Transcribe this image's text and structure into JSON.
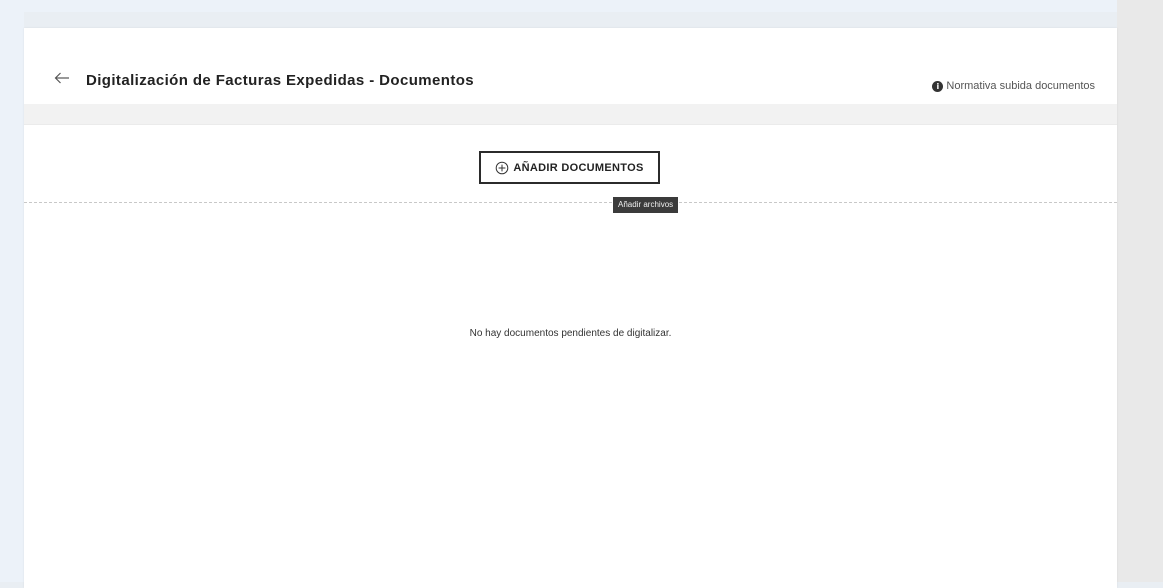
{
  "header": {
    "title": "Digitalización de Facturas Expedidas - Documentos",
    "back_icon": "arrow-left-icon",
    "help_link_label": "Normativa subida documentos",
    "help_icon": "info-icon"
  },
  "toolbar": {
    "add_button_label": "AÑADIR DOCUMENTOS",
    "add_button_icon": "plus-circle-icon",
    "tooltip": "Añadir archivos"
  },
  "main": {
    "empty_message": "No hay documentos pendientes de digitalizar."
  },
  "colors": {
    "page_background": "#ecf2f9",
    "card_background": "#ffffff",
    "button_border": "#2b2b2b",
    "tooltip_background": "#3b3b3b"
  }
}
